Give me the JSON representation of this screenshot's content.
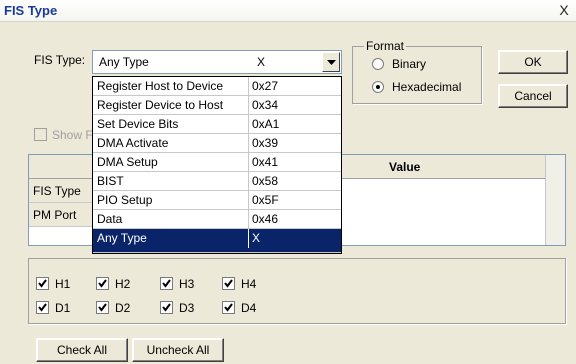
{
  "window": {
    "title": "FIS Type",
    "close_glyph": "X"
  },
  "fis_type": {
    "label": "FIS Type:",
    "selected_name": "Any Type",
    "selected_code": "X",
    "options": [
      {
        "name": "Register Host to Device",
        "code": "0x27"
      },
      {
        "name": "Register Device to Host",
        "code": "0x34"
      },
      {
        "name": "Set Device Bits",
        "code": "0xA1"
      },
      {
        "name": "DMA Activate",
        "code": "0x39"
      },
      {
        "name": "DMA Setup",
        "code": "0x41"
      },
      {
        "name": "BIST",
        "code": "0x58"
      },
      {
        "name": "PIO Setup",
        "code": "0x5F"
      },
      {
        "name": "Data",
        "code": "0x46"
      },
      {
        "name": "Any Type",
        "code": "X"
      }
    ]
  },
  "format": {
    "title": "Format",
    "options": [
      "Binary",
      "Hexadecimal"
    ],
    "selected": "Hexadecimal"
  },
  "buttons": {
    "ok": "OK",
    "cancel": "Cancel",
    "check_all": "Check All",
    "uncheck_all": "Uncheck All"
  },
  "show_label_partial": "Show F",
  "grid": {
    "value_header": "Value",
    "rows": [
      "FIS Type",
      "PM Port"
    ]
  },
  "checkboxes": {
    "row1": [
      "H1",
      "H2",
      "H3",
      "H4"
    ],
    "row2": [
      "D1",
      "D2",
      "D3",
      "D4"
    ]
  },
  "colors": {
    "title_text": "#1a3a9a",
    "selection": "#0a246a",
    "face": "#ece9d8"
  }
}
